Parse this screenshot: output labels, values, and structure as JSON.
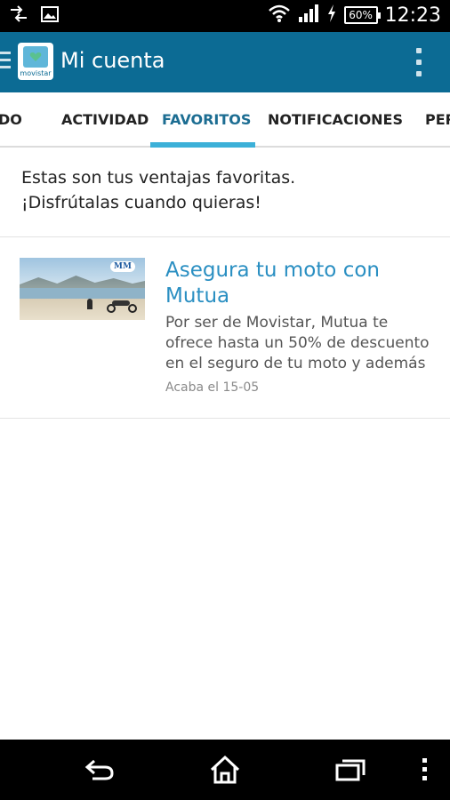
{
  "status_bar": {
    "time": "12:23",
    "battery_percent": "60%",
    "icons": [
      "data-transfer-icon",
      "image-notification-icon",
      "wifi-icon",
      "signal-icon",
      "charging-icon",
      "battery-icon"
    ]
  },
  "app_bar": {
    "title": "Mi cuenta",
    "logo_text": "movistar",
    "colors": {
      "background": "#0c6b94"
    }
  },
  "tabs": [
    {
      "label": "DO",
      "active": false
    },
    {
      "label": "ACTIVIDAD",
      "active": false
    },
    {
      "label": "FAVORITOS",
      "active": true
    },
    {
      "label": "NOTIFICACIONES",
      "active": false
    },
    {
      "label": "PER",
      "active": false
    }
  ],
  "intro": {
    "line1": "Estas son tus ventajas favoritas.",
    "line2": "¡Disfrútalas cuando quieras!"
  },
  "favorites": [
    {
      "title": "Asegura tu moto con Mutua",
      "description": "Por ser de Movistar, Mutua te ofrece hasta un 50% de descuento en el seguro de tu moto y además",
      "expires": "Acaba el 15-05",
      "image_badge": "MM"
    }
  ],
  "nav_bar": {
    "icons": [
      "back-icon",
      "home-icon",
      "recent-apps-icon",
      "menu-icon"
    ]
  },
  "colors": {
    "accent": "#3cb0d8",
    "active_tab": "#1c6d92",
    "card_title": "#2a8fc2"
  }
}
